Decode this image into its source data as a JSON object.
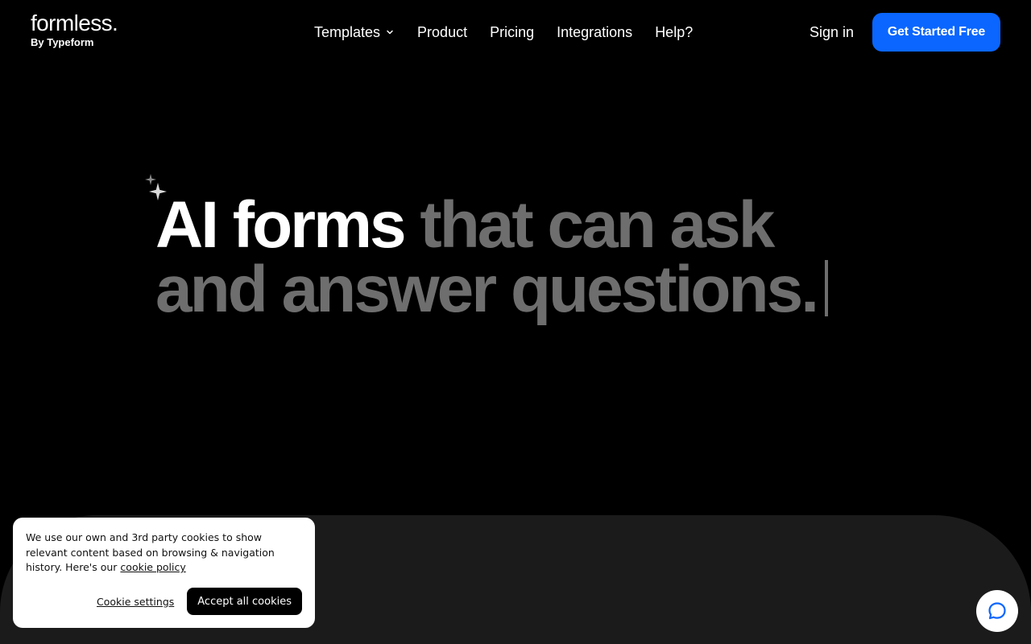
{
  "brand": {
    "name": "formless.",
    "byline": "By Typeform"
  },
  "nav": {
    "items": [
      {
        "label": "Templates",
        "has_dropdown": true
      },
      {
        "label": "Product"
      },
      {
        "label": "Pricing"
      },
      {
        "label": "Integrations"
      },
      {
        "label": "Help?"
      }
    ],
    "sign_in": "Sign in",
    "cta": "Get Started Free"
  },
  "hero": {
    "highlight": "AI forms",
    "rest_line1": " that can ask",
    "line2": "and answer questions."
  },
  "cookie_banner": {
    "text": "We use our own and 3rd party cookies to show relevant content based on browsing & navigation history. Here's our ",
    "link_label": "cookie policy",
    "settings_label": "Cookie settings",
    "accept_label": "Accept all cookies"
  },
  "icons": {
    "sparkle": "sparkle-icon",
    "chevron": "chevron-down-icon",
    "chat": "chat-bubble-icon"
  },
  "colors": {
    "background": "#000000",
    "accent": "#0a66ff",
    "muted_text": "#6e6e6e",
    "panel": "#1b1b1b"
  }
}
